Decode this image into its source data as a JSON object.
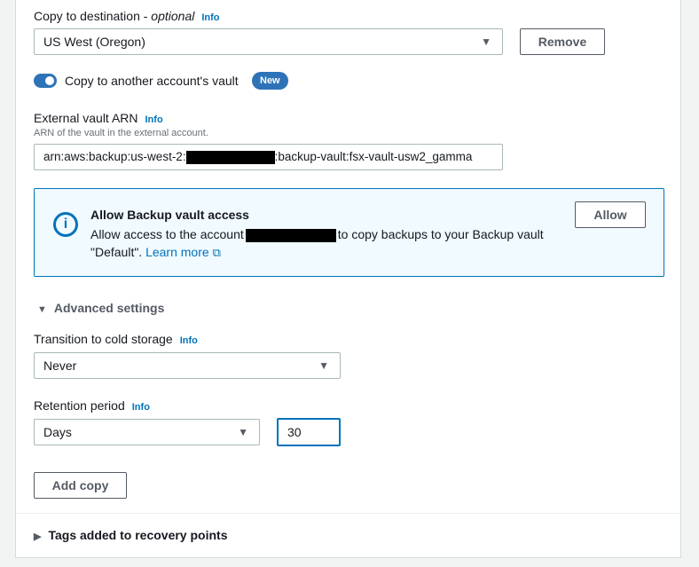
{
  "copy_destination": {
    "label": "Copy to destination - ",
    "optional": "optional",
    "info": "Info",
    "value": "US West (Oregon)",
    "remove": "Remove"
  },
  "toggle": {
    "label": "Copy to another account's vault",
    "badge": "New",
    "on": true
  },
  "arn": {
    "label": "External vault ARN",
    "info": "Info",
    "description": "ARN of the vault in the external account.",
    "value_prefix": "arn:aws:backup:us-west-2:",
    "value_suffix": ":backup-vault:fsx-vault-usw2_gamma"
  },
  "alert": {
    "title": "Allow Backup vault access",
    "text1": "Allow access to the account",
    "text2": "to copy backups to your Backup vault",
    "text3": "\"Default\". ",
    "link": "Learn more",
    "button": "Allow"
  },
  "advanced": {
    "label": "Advanced settings"
  },
  "cold": {
    "label": "Transition to cold storage",
    "info": "Info",
    "value": "Never"
  },
  "retention": {
    "label": "Retention period",
    "info": "Info",
    "unit": "Days",
    "value": "30"
  },
  "add_copy": "Add copy",
  "tags": {
    "label": "Tags added to recovery points"
  }
}
